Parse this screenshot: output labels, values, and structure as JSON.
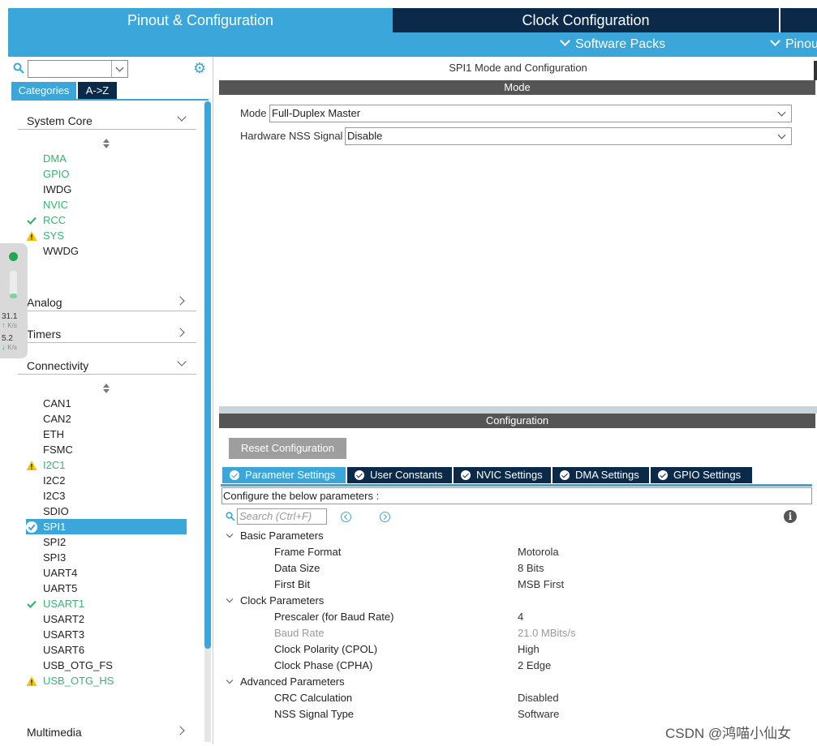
{
  "top_tabs": {
    "pinout": "Pinout & Configuration",
    "clock": "Clock Configuration"
  },
  "sub_bar": {
    "software_packs": "Software Packs",
    "pinout": "Pinou"
  },
  "left": {
    "category_tabs": [
      "Categories",
      "A->Z"
    ],
    "system_core": {
      "label": "System Core",
      "items": [
        {
          "name": "DMA",
          "state": "green"
        },
        {
          "name": "GPIO",
          "state": "green"
        },
        {
          "name": "IWDG",
          "state": "normal"
        },
        {
          "name": "NVIC",
          "state": "green"
        },
        {
          "name": "RCC",
          "state": "check"
        },
        {
          "name": "SYS",
          "state": "warning"
        },
        {
          "name": "WWDG",
          "state": "normal"
        }
      ]
    },
    "analog": "Analog",
    "timers": "Timers",
    "connectivity": {
      "label": "Connectivity",
      "items": [
        {
          "name": "CAN1",
          "state": "normal"
        },
        {
          "name": "CAN2",
          "state": "normal"
        },
        {
          "name": "ETH",
          "state": "normal"
        },
        {
          "name": "FSMC",
          "state": "normal"
        },
        {
          "name": "I2C1",
          "state": "warning"
        },
        {
          "name": "I2C2",
          "state": "normal"
        },
        {
          "name": "I2C3",
          "state": "normal"
        },
        {
          "name": "SDIO",
          "state": "normal"
        },
        {
          "name": "SPI1",
          "state": "selected"
        },
        {
          "name": "SPI2",
          "state": "normal"
        },
        {
          "name": "SPI3",
          "state": "normal"
        },
        {
          "name": "UART4",
          "state": "normal"
        },
        {
          "name": "UART5",
          "state": "normal"
        },
        {
          "name": "USART1",
          "state": "check"
        },
        {
          "name": "USART2",
          "state": "normal"
        },
        {
          "name": "USART3",
          "state": "normal"
        },
        {
          "name": "USART6",
          "state": "normal"
        },
        {
          "name": "USB_OTG_FS",
          "state": "normal"
        },
        {
          "name": "USB_OTG_HS",
          "state": "warning"
        }
      ]
    },
    "multimedia": "Multimedia"
  },
  "float_widget": {
    "up_value": "31.1",
    "up_unit": "K/s",
    "down_value": "5.2",
    "down_unit": "K/s"
  },
  "right": {
    "title": "SPI1 Mode and Configuration",
    "mode_bar": "Mode",
    "mode_label": "Mode",
    "mode_value": "Full-Duplex Master",
    "nss_label": "Hardware NSS Signal",
    "nss_value": "Disable",
    "config_bar": "Configuration",
    "reset_button": "Reset Configuration",
    "param_tabs": [
      "Parameter Settings",
      "User Constants",
      "NVIC Settings",
      "DMA Settings",
      "GPIO Settings"
    ],
    "configure_text": "Configure the below parameters :",
    "search_placeholder": "Search (Ctrl+F)",
    "groups": [
      {
        "label": "Basic Parameters",
        "params": [
          {
            "name": "Frame Format",
            "value": "Motorola",
            "disabled": false
          },
          {
            "name": "Data Size",
            "value": "8 Bits",
            "disabled": false
          },
          {
            "name": "First Bit",
            "value": "MSB First",
            "disabled": false
          }
        ]
      },
      {
        "label": "Clock Parameters",
        "params": [
          {
            "name": "Prescaler (for Baud Rate)",
            "value": "4",
            "disabled": false
          },
          {
            "name": "Baud Rate",
            "value": "21.0 MBits/s",
            "disabled": true
          },
          {
            "name": "Clock Polarity (CPOL)",
            "value": "High",
            "disabled": false
          },
          {
            "name": "Clock Phase (CPHA)",
            "value": "2 Edge",
            "disabled": false
          }
        ]
      },
      {
        "label": "Advanced Parameters",
        "params": [
          {
            "name": "CRC Calculation",
            "value": "Disabled",
            "disabled": false
          },
          {
            "name": "NSS Signal Type",
            "value": "Software",
            "disabled": false
          }
        ]
      }
    ]
  },
  "watermark": "CSDN @鸿喵小仙女",
  "colors": {
    "accent": "#3aa6d9",
    "dark": "#0b2a4a",
    "ok": "#3bb273",
    "warn": "#f5c400",
    "header": "#555555"
  }
}
